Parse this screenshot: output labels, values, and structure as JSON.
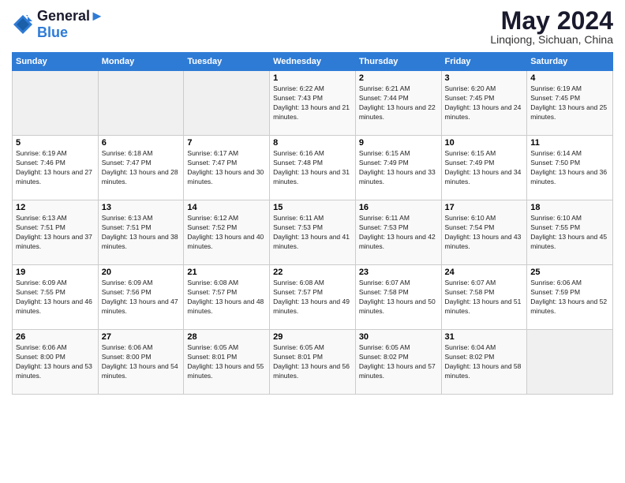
{
  "header": {
    "logo_line1": "General",
    "logo_line2": "Blue",
    "month": "May 2024",
    "location": "Linqiong, Sichuan, China"
  },
  "weekdays": [
    "Sunday",
    "Monday",
    "Tuesday",
    "Wednesday",
    "Thursday",
    "Friday",
    "Saturday"
  ],
  "weeks": [
    [
      {
        "day": "",
        "sunrise": "",
        "sunset": "",
        "daylight": ""
      },
      {
        "day": "",
        "sunrise": "",
        "sunset": "",
        "daylight": ""
      },
      {
        "day": "",
        "sunrise": "",
        "sunset": "",
        "daylight": ""
      },
      {
        "day": "1",
        "sunrise": "Sunrise: 6:22 AM",
        "sunset": "Sunset: 7:43 PM",
        "daylight": "Daylight: 13 hours and 21 minutes."
      },
      {
        "day": "2",
        "sunrise": "Sunrise: 6:21 AM",
        "sunset": "Sunset: 7:44 PM",
        "daylight": "Daylight: 13 hours and 22 minutes."
      },
      {
        "day": "3",
        "sunrise": "Sunrise: 6:20 AM",
        "sunset": "Sunset: 7:45 PM",
        "daylight": "Daylight: 13 hours and 24 minutes."
      },
      {
        "day": "4",
        "sunrise": "Sunrise: 6:19 AM",
        "sunset": "Sunset: 7:45 PM",
        "daylight": "Daylight: 13 hours and 25 minutes."
      }
    ],
    [
      {
        "day": "5",
        "sunrise": "Sunrise: 6:19 AM",
        "sunset": "Sunset: 7:46 PM",
        "daylight": "Daylight: 13 hours and 27 minutes."
      },
      {
        "day": "6",
        "sunrise": "Sunrise: 6:18 AM",
        "sunset": "Sunset: 7:47 PM",
        "daylight": "Daylight: 13 hours and 28 minutes."
      },
      {
        "day": "7",
        "sunrise": "Sunrise: 6:17 AM",
        "sunset": "Sunset: 7:47 PM",
        "daylight": "Daylight: 13 hours and 30 minutes."
      },
      {
        "day": "8",
        "sunrise": "Sunrise: 6:16 AM",
        "sunset": "Sunset: 7:48 PM",
        "daylight": "Daylight: 13 hours and 31 minutes."
      },
      {
        "day": "9",
        "sunrise": "Sunrise: 6:15 AM",
        "sunset": "Sunset: 7:49 PM",
        "daylight": "Daylight: 13 hours and 33 minutes."
      },
      {
        "day": "10",
        "sunrise": "Sunrise: 6:15 AM",
        "sunset": "Sunset: 7:49 PM",
        "daylight": "Daylight: 13 hours and 34 minutes."
      },
      {
        "day": "11",
        "sunrise": "Sunrise: 6:14 AM",
        "sunset": "Sunset: 7:50 PM",
        "daylight": "Daylight: 13 hours and 36 minutes."
      }
    ],
    [
      {
        "day": "12",
        "sunrise": "Sunrise: 6:13 AM",
        "sunset": "Sunset: 7:51 PM",
        "daylight": "Daylight: 13 hours and 37 minutes."
      },
      {
        "day": "13",
        "sunrise": "Sunrise: 6:13 AM",
        "sunset": "Sunset: 7:51 PM",
        "daylight": "Daylight: 13 hours and 38 minutes."
      },
      {
        "day": "14",
        "sunrise": "Sunrise: 6:12 AM",
        "sunset": "Sunset: 7:52 PM",
        "daylight": "Daylight: 13 hours and 40 minutes."
      },
      {
        "day": "15",
        "sunrise": "Sunrise: 6:11 AM",
        "sunset": "Sunset: 7:53 PM",
        "daylight": "Daylight: 13 hours and 41 minutes."
      },
      {
        "day": "16",
        "sunrise": "Sunrise: 6:11 AM",
        "sunset": "Sunset: 7:53 PM",
        "daylight": "Daylight: 13 hours and 42 minutes."
      },
      {
        "day": "17",
        "sunrise": "Sunrise: 6:10 AM",
        "sunset": "Sunset: 7:54 PM",
        "daylight": "Daylight: 13 hours and 43 minutes."
      },
      {
        "day": "18",
        "sunrise": "Sunrise: 6:10 AM",
        "sunset": "Sunset: 7:55 PM",
        "daylight": "Daylight: 13 hours and 45 minutes."
      }
    ],
    [
      {
        "day": "19",
        "sunrise": "Sunrise: 6:09 AM",
        "sunset": "Sunset: 7:55 PM",
        "daylight": "Daylight: 13 hours and 46 minutes."
      },
      {
        "day": "20",
        "sunrise": "Sunrise: 6:09 AM",
        "sunset": "Sunset: 7:56 PM",
        "daylight": "Daylight: 13 hours and 47 minutes."
      },
      {
        "day": "21",
        "sunrise": "Sunrise: 6:08 AM",
        "sunset": "Sunset: 7:57 PM",
        "daylight": "Daylight: 13 hours and 48 minutes."
      },
      {
        "day": "22",
        "sunrise": "Sunrise: 6:08 AM",
        "sunset": "Sunset: 7:57 PM",
        "daylight": "Daylight: 13 hours and 49 minutes."
      },
      {
        "day": "23",
        "sunrise": "Sunrise: 6:07 AM",
        "sunset": "Sunset: 7:58 PM",
        "daylight": "Daylight: 13 hours and 50 minutes."
      },
      {
        "day": "24",
        "sunrise": "Sunrise: 6:07 AM",
        "sunset": "Sunset: 7:58 PM",
        "daylight": "Daylight: 13 hours and 51 minutes."
      },
      {
        "day": "25",
        "sunrise": "Sunrise: 6:06 AM",
        "sunset": "Sunset: 7:59 PM",
        "daylight": "Daylight: 13 hours and 52 minutes."
      }
    ],
    [
      {
        "day": "26",
        "sunrise": "Sunrise: 6:06 AM",
        "sunset": "Sunset: 8:00 PM",
        "daylight": "Daylight: 13 hours and 53 minutes."
      },
      {
        "day": "27",
        "sunrise": "Sunrise: 6:06 AM",
        "sunset": "Sunset: 8:00 PM",
        "daylight": "Daylight: 13 hours and 54 minutes."
      },
      {
        "day": "28",
        "sunrise": "Sunrise: 6:05 AM",
        "sunset": "Sunset: 8:01 PM",
        "daylight": "Daylight: 13 hours and 55 minutes."
      },
      {
        "day": "29",
        "sunrise": "Sunrise: 6:05 AM",
        "sunset": "Sunset: 8:01 PM",
        "daylight": "Daylight: 13 hours and 56 minutes."
      },
      {
        "day": "30",
        "sunrise": "Sunrise: 6:05 AM",
        "sunset": "Sunset: 8:02 PM",
        "daylight": "Daylight: 13 hours and 57 minutes."
      },
      {
        "day": "31",
        "sunrise": "Sunrise: 6:04 AM",
        "sunset": "Sunset: 8:02 PM",
        "daylight": "Daylight: 13 hours and 58 minutes."
      },
      {
        "day": "",
        "sunrise": "",
        "sunset": "",
        "daylight": ""
      }
    ]
  ]
}
